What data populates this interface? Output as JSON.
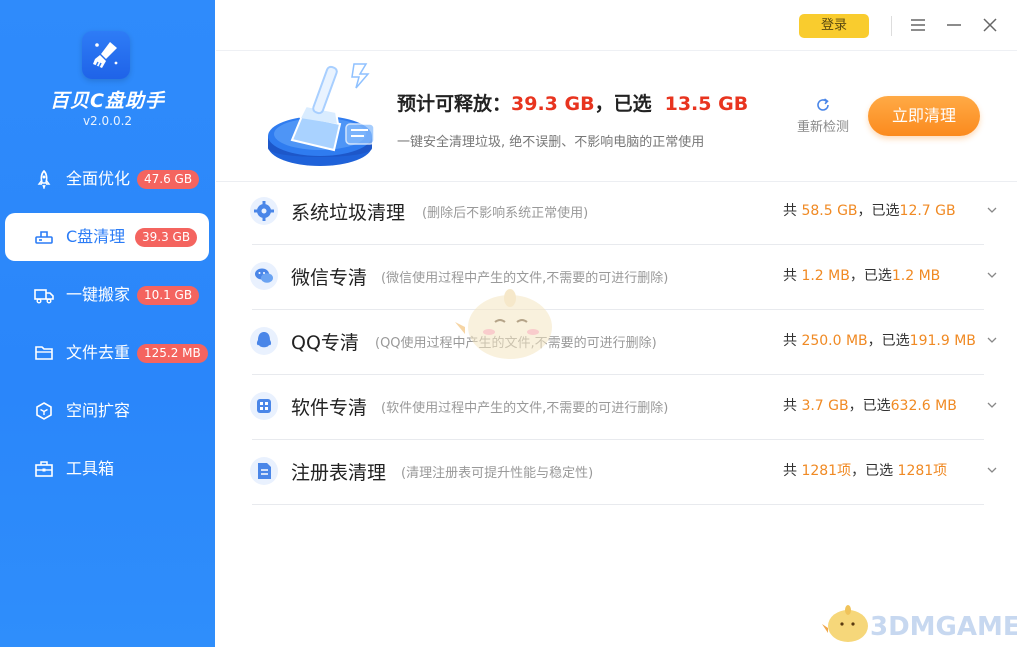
{
  "app": {
    "title": "百贝C盘助手",
    "version": "v2.0.0.2"
  },
  "titlebar": {
    "login_label": "登录",
    "icons": [
      "menu-icon",
      "minimize-icon",
      "close-icon"
    ]
  },
  "nav": [
    {
      "label": "全面优化",
      "badge": "47.6 GB",
      "icon": "rocket-icon",
      "active": false
    },
    {
      "label": "C盘清理",
      "badge": "39.3 GB",
      "icon": "disk-clean-icon",
      "active": true
    },
    {
      "label": "一键搬家",
      "badge": "10.1 GB",
      "icon": "truck-icon",
      "active": false
    },
    {
      "label": "文件去重",
      "badge": "125.2 MB",
      "icon": "folder-icon",
      "active": false
    },
    {
      "label": "空间扩容",
      "badge": "",
      "icon": "cube-icon",
      "active": false
    },
    {
      "label": "工具箱",
      "badge": "",
      "icon": "toolbox-icon",
      "active": false
    }
  ],
  "hero": {
    "prefix": "预计可释放：",
    "release": "39.3 GB",
    "middle": "，已选",
    "selected": "13.5 GB",
    "subtitle": "一键安全清理垃圾, 绝不误删、不影响电脑的正常使用",
    "rescan_label": "重新检测",
    "clean_label": "立即清理"
  },
  "rows": [
    {
      "title": "系统垃圾清理",
      "desc": "(删除后不影响系统正常使用)",
      "total_prefix": "共 ",
      "total": "58.5 GB",
      "sel_prefix": "，已选",
      "selected": "12.7 GB",
      "icon": "gear-icon"
    },
    {
      "title": "微信专清",
      "desc": "(微信使用过程中产生的文件,不需要的可进行删除)",
      "total_prefix": "共 ",
      "total": "1.2 MB",
      "sel_prefix": "，已选",
      "selected": "1.2 MB",
      "icon": "wechat-icon"
    },
    {
      "title": "QQ专清",
      "desc": "(QQ使用过程中产生的文件,不需要的可进行删除)",
      "total_prefix": "共 ",
      "total": "250.0 MB",
      "sel_prefix": "，已选",
      "selected": "191.9 MB",
      "icon": "qq-icon"
    },
    {
      "title": "软件专清",
      "desc": "(软件使用过程中产生的文件,不需要的可进行删除)",
      "total_prefix": "共 ",
      "total": "3.7 GB",
      "sel_prefix": "，已选",
      "selected": "632.6 MB",
      "icon": "apps-icon"
    },
    {
      "title": "注册表清理",
      "desc": "(清理注册表可提升性能与稳定性)",
      "total_prefix": "共 ",
      "total": "1281项",
      "sel_prefix": "，已选 ",
      "selected": "1281项",
      "icon": "registry-icon"
    }
  ],
  "watermark": {
    "text": "3DMGAME"
  },
  "colors": {
    "sidebar": "#2f8bfb",
    "accent": "#2b7cf6",
    "badge": "#f4645f",
    "highlight_red": "#e8341f",
    "highlight_orange": "#f08a24",
    "clean_button": "#fb8a1e",
    "login_button": "#f9cc2e"
  }
}
